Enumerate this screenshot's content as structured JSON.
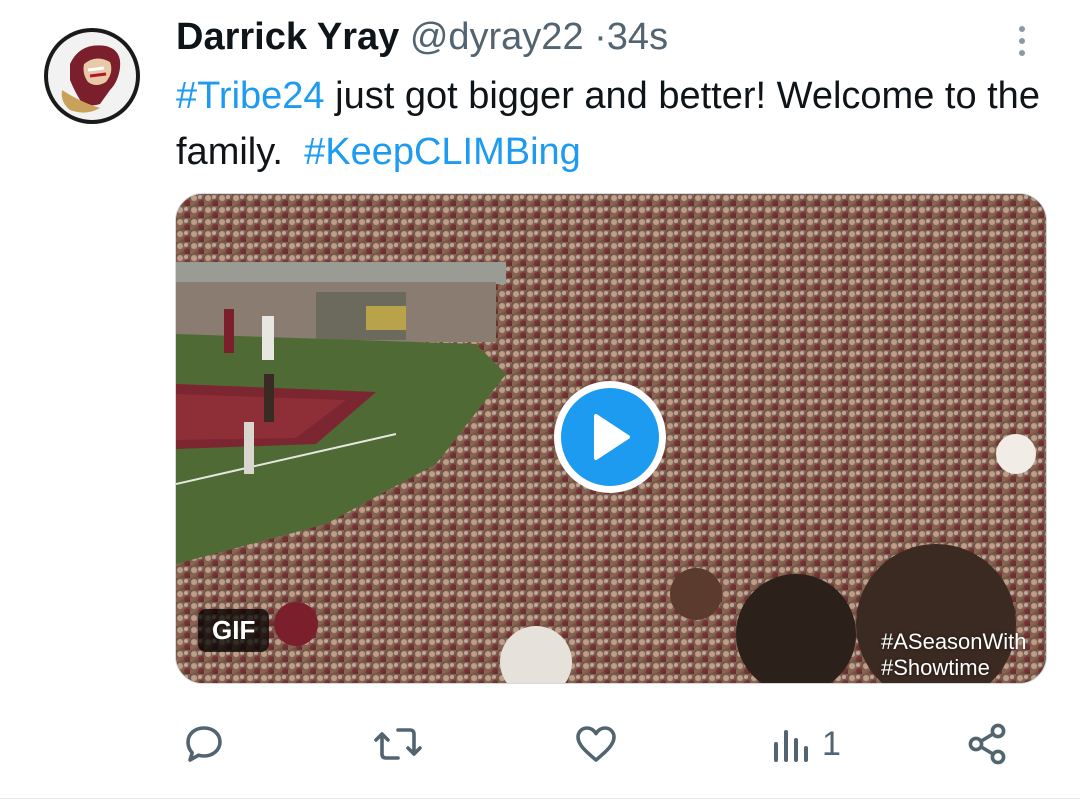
{
  "tweet": {
    "author_name": "Darrick Yray",
    "handle": "@dyray22",
    "separator": "·",
    "time": "34s",
    "text": {
      "hashtag1": "#Tribe24",
      "part1": " just got bigger and better! Welcome to the family.  ",
      "hashtag2": "#KeepCLIMBing"
    }
  },
  "media": {
    "badge": "GIF",
    "watermark_line1": "#ASeasonWith",
    "watermark_line2": "#Showtime"
  },
  "actions": {
    "reply_icon": "reply-icon",
    "retweet_icon": "retweet-icon",
    "like_icon": "heart-icon",
    "views_icon": "views-icon",
    "views_count": "1",
    "share_icon": "share-icon"
  },
  "colors": {
    "accent": "#1d9bf0",
    "secondary_text": "#536471",
    "primary_text": "#0f1419"
  }
}
